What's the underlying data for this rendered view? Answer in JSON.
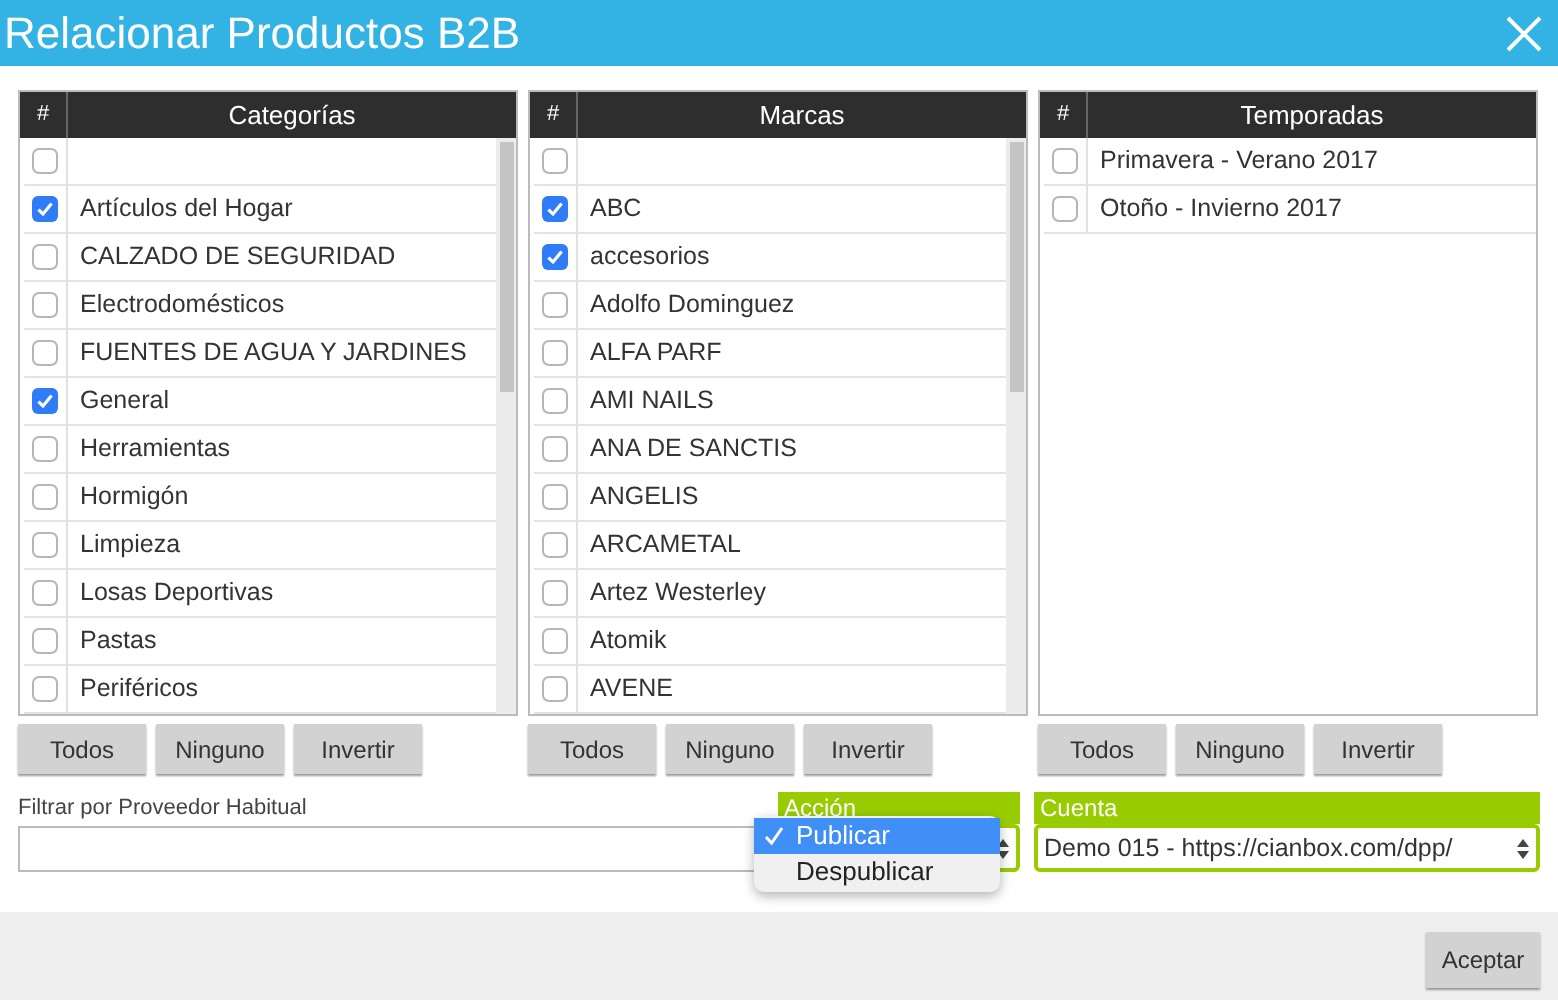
{
  "window": {
    "title": "Relacionar Productos B2B"
  },
  "panels": [
    {
      "hash": "#",
      "title": "Categorías",
      "scrollable": true,
      "items": [
        {
          "checked": false
        },
        {
          "label": "Artículos del Hogar",
          "checked": true
        },
        {
          "label": "CALZADO DE SEGURIDAD",
          "checked": false
        },
        {
          "label": "Electrodomésticos",
          "checked": false
        },
        {
          "label": "FUENTES DE AGUA Y JARDINES",
          "checked": false
        },
        {
          "label": "General",
          "checked": true
        },
        {
          "label": "Herramientas",
          "checked": false
        },
        {
          "label": "Hormigón",
          "checked": false
        },
        {
          "label": "Limpieza",
          "checked": false
        },
        {
          "label": "Losas Deportivas",
          "checked": false
        },
        {
          "label": "Pastas",
          "checked": false
        },
        {
          "label": "Periféricos",
          "checked": false
        }
      ],
      "buttons": [
        "Todos",
        "Ninguno",
        "Invertir"
      ]
    },
    {
      "hash": "#",
      "title": "Marcas",
      "scrollable": true,
      "items": [
        {
          "checked": false
        },
        {
          "label": "ABC",
          "checked": true
        },
        {
          "label": "accesorios",
          "checked": true
        },
        {
          "label": "Adolfo Dominguez",
          "checked": false
        },
        {
          "label": "ALFA PARF",
          "checked": false
        },
        {
          "label": "AMI NAILS",
          "checked": false
        },
        {
          "label": "ANA DE SANCTIS",
          "checked": false
        },
        {
          "label": "ANGELIS",
          "checked": false
        },
        {
          "label": "ARCAMETAL",
          "checked": false
        },
        {
          "label": "Artez Westerley",
          "checked": false
        },
        {
          "label": "Atomik",
          "checked": false
        },
        {
          "label": "AVENE",
          "checked": false
        }
      ],
      "buttons": [
        "Todos",
        "Ninguno",
        "Invertir"
      ]
    },
    {
      "hash": "#",
      "title": "Temporadas",
      "scrollable": false,
      "items": [
        {
          "label": "Primavera - Verano 2017",
          "checked": false
        },
        {
          "label": "Otoño - Invierno 2017",
          "checked": false
        }
      ],
      "buttons": [
        "Todos",
        "Ninguno",
        "Invertir"
      ]
    }
  ],
  "filter": {
    "label": "Filtrar por Proveedor Habitual"
  },
  "accion": {
    "label": "Acción",
    "expanded": true,
    "options": [
      {
        "label": "Publicar",
        "selected": true
      },
      {
        "label": "Despublicar",
        "selected": false
      }
    ]
  },
  "cuenta": {
    "label": "Cuenta",
    "value": "Demo 015 - https://cianbox.com/dpp/"
  },
  "footer": {
    "button": "Aceptar"
  }
}
